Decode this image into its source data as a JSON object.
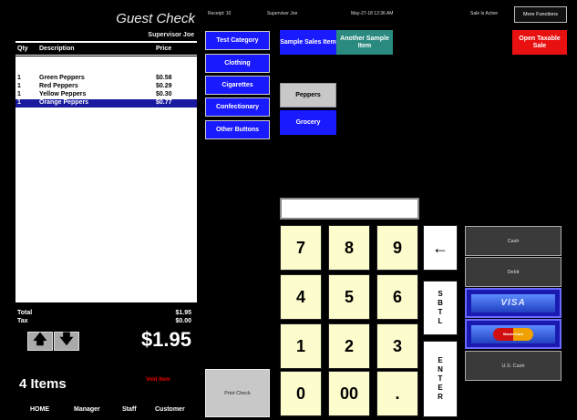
{
  "topbar": {
    "receipt": "Receipt: 10",
    "supervisor": "Supervisor Joe",
    "datetime": "May-27-18  12:36 AM",
    "sale_status": "Sale Is Active",
    "more_functions": "More Functions"
  },
  "check": {
    "title": "Guest Check",
    "server": "Supervisor Joe",
    "columns": {
      "qty": "Qty",
      "description": "Description",
      "price": "Price"
    },
    "items": [
      {
        "qty": "1",
        "description": "Green Peppers",
        "price": "$0.58",
        "selected": false
      },
      {
        "qty": "1",
        "description": "Red Peppers",
        "price": "$0.29",
        "selected": false
      },
      {
        "qty": "1",
        "description": "Yellow Peppers",
        "price": "$0.30",
        "selected": false
      },
      {
        "qty": "1",
        "description": "Orange Peppers",
        "price": "$0.77",
        "selected": true
      }
    ],
    "total_label": "Total",
    "total_value": "$1.95",
    "tax_label": "Tax",
    "tax_value": "$0.00",
    "grand_total": "$1.95",
    "up_icon": "arrow-up-icon",
    "down_icon": "arrow-down-icon",
    "up_glyph": "🡅",
    "down_glyph": "🡇"
  },
  "footer": {
    "item_count": "4 Items",
    "void_item": "Void Item",
    "nav": [
      "HOME",
      "Manager",
      "Staff",
      "Customer"
    ]
  },
  "categories": [
    "Test Category",
    "Clothing",
    "Cigarettes",
    "Confectionary",
    "Other Buttons"
  ],
  "items": {
    "sample_sales_item": "Sample Sales Item",
    "another_sample_item": "Another Sample Item",
    "open_taxable_sale": "Open Taxable Sale",
    "peppers": "Peppers",
    "grocery": "Grocery"
  },
  "print_check": "Print Check",
  "entry_value": "",
  "keypad": {
    "keys": [
      "7",
      "8",
      "9",
      "4",
      "5",
      "6",
      "1",
      "2",
      "3",
      "0",
      "00",
      "."
    ],
    "backspace": "←",
    "subtotal": "SBTL",
    "enter": "ENTER"
  },
  "payments": {
    "cash": "Cash",
    "debit": "Debit",
    "visa": "VISA",
    "mastercard": "MasterCard",
    "us_cash": "U.S. Cash"
  },
  "colors": {
    "category_blue": "#1a1aff",
    "selected_row": "#1a1aa0",
    "teal_item": "#2a8a80",
    "open_sale_red": "#e81010",
    "keypad_yellow": "#fdfccc"
  }
}
